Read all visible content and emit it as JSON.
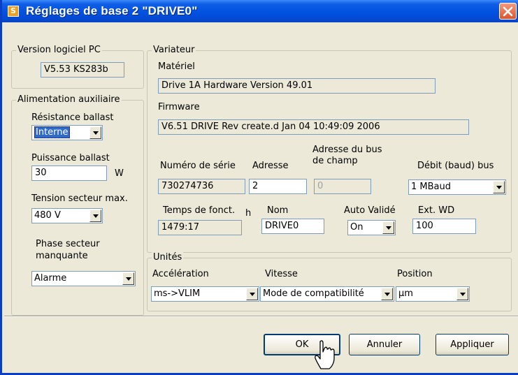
{
  "window": {
    "title": "Réglages de base 2 \"DRIVE0\"",
    "app_icon": "app-icon",
    "close_icon": "close-icon"
  },
  "software_version": {
    "legend": "Version logiciel PC",
    "value": "V5.53 KS283b"
  },
  "aux_power": {
    "legend": "Alimentation auxiliaire",
    "ballast_resistance_label": "Résistance ballast",
    "ballast_resistance_value": "Interne",
    "ballast_power_label": "Puissance ballast",
    "ballast_power_value": "30",
    "ballast_power_unit": "W",
    "max_voltage_label": "Tension secteur max.",
    "max_voltage_value": "480 V",
    "missing_phase_label_1": "Phase secteur",
    "missing_phase_label_2": "manquante",
    "missing_phase_value": "Alarme"
  },
  "drive": {
    "legend": "Variateur",
    "hardware_label": "Matériel",
    "hardware_value": "Drive 1A Hardware Version 49.01",
    "firmware_label": "Firmware",
    "firmware_value": "V6.51 DRIVE Rev create.d Jan 04 10:49:09 2006",
    "serial_label": "Numéro de série",
    "serial_value": "730274736",
    "address_label": "Adresse",
    "address_value": "2",
    "fieldbus_label_1": "Adresse du bus",
    "fieldbus_label_2": "de champ",
    "fieldbus_value": "0",
    "baud_label": "Débit (baud) bus",
    "baud_value": "1 MBaud",
    "runtime_label": "Temps de fonct.",
    "runtime_unit": "h",
    "runtime_value": "1479:17",
    "name_label": "Nom",
    "name_value": "DRIVE0",
    "auto_valid_label": "Auto Validé",
    "auto_valid_value": "On",
    "ext_wd_label": "Ext. WD",
    "ext_wd_value": "100"
  },
  "units": {
    "legend": "Unités",
    "acceleration_label": "Accélération",
    "acceleration_value": "ms->VLIM",
    "speed_label": "Vitesse",
    "speed_value": "Mode de compatibilité",
    "position_label": "Position",
    "position_value": "µm"
  },
  "buttons": {
    "ok": "OK",
    "cancel": "Annuler",
    "apply": "Appliquer"
  },
  "cursor_icon": "pointer-cursor-icon"
}
